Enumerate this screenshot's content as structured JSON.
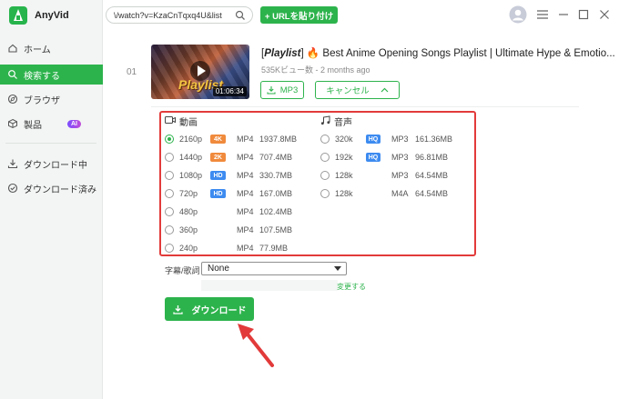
{
  "app": {
    "name": "AnyVid"
  },
  "sidebar": {
    "items": [
      {
        "label": "ホーム",
        "icon": "home-icon"
      },
      {
        "label": "検索する",
        "icon": "search-icon"
      },
      {
        "label": "ブラウザ",
        "icon": "compass-icon"
      },
      {
        "label": "製品",
        "icon": "box-icon",
        "badge": "AI"
      },
      {
        "label": "ダウンロード中",
        "icon": "download-icon"
      },
      {
        "label": "ダウンロード済み",
        "icon": "check-circle-icon"
      }
    ],
    "active": "検索する"
  },
  "topbar": {
    "url_value": "\\/watch?v=KzaCnTqxq4U&list",
    "paste_label": "+ URLを貼り付け"
  },
  "video": {
    "index": "01",
    "thumb_text": "Playlist",
    "duration": "01:06:34",
    "title_prefix": "Playlist",
    "title_rest": "Best Anime Opening Songs Playlist | Ultimate Hype & Emotio...",
    "meta": "535Kビュー数 - 2 months ago",
    "mp3_label": "MP3",
    "cancel_label": "キャンセル"
  },
  "formats": {
    "video_header": "動画",
    "audio_header": "音声",
    "video": [
      {
        "res": "2160p",
        "badge": "4K",
        "format": "MP4",
        "size": "1937.8MB",
        "selected": true
      },
      {
        "res": "1440p",
        "badge": "2K",
        "format": "MP4",
        "size": "707.4MB",
        "selected": false
      },
      {
        "res": "1080p",
        "badge": "HD",
        "format": "MP4",
        "size": "330.7MB",
        "selected": false
      },
      {
        "res": "720p",
        "badge": "HD",
        "format": "MP4",
        "size": "167.0MB",
        "selected": false
      },
      {
        "res": "480p",
        "badge": "",
        "format": "MP4",
        "size": "102.4MB",
        "selected": false
      },
      {
        "res": "360p",
        "badge": "",
        "format": "MP4",
        "size": "107.5MB",
        "selected": false
      },
      {
        "res": "240p",
        "badge": "",
        "format": "MP4",
        "size": "77.9MB",
        "selected": false
      }
    ],
    "audio": [
      {
        "bitrate": "320k",
        "badge": "HQ",
        "format": "MP3",
        "size": "161.36MB"
      },
      {
        "bitrate": "192k",
        "badge": "HQ",
        "format": "MP3",
        "size": "96.81MB"
      },
      {
        "bitrate": "128k",
        "badge": "",
        "format": "MP3",
        "size": "64.54MB"
      },
      {
        "bitrate": "128k",
        "badge": "",
        "format": "M4A",
        "size": "64.54MB"
      }
    ]
  },
  "subtitle": {
    "label": "字幕/歌詞",
    "value": "None",
    "change_label": "変更する"
  },
  "download_label": "ダウンロード",
  "colors": {
    "accent": "#2db34c",
    "highlight": "#e23a3a",
    "badge_4k": "#f08a3c",
    "badge_2k": "#f08a3c",
    "badge_hd": "#3d8bf0",
    "badge_hq": "#3d8bf0"
  }
}
